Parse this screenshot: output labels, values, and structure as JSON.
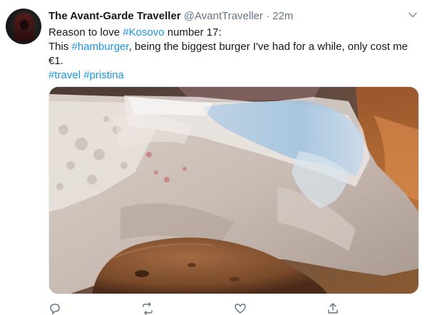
{
  "tweet": {
    "author_name": "The Avant-Garde Traveller",
    "author_handle": "@AvantTraveller",
    "separator": "·",
    "time": "22m",
    "line1_prefix": "Reason to love ",
    "line1_tag": "#Kosovo",
    "line1_suffix": " number 17:",
    "line2_prefix": "This ",
    "line2_tag": "#hamburger",
    "line2_suffix": ", being the biggest burger I've had for a while, only cost me €1.",
    "tags_line": [
      "#travel",
      "#pristina"
    ]
  },
  "icons": {
    "menu": "chevron-down-icon",
    "reply": "reply-icon",
    "retweet": "retweet-icon",
    "like": "heart-icon",
    "share": "share-icon"
  },
  "colors": {
    "link": "#1b95e0",
    "secondary": "#657786",
    "text": "#14171a"
  }
}
